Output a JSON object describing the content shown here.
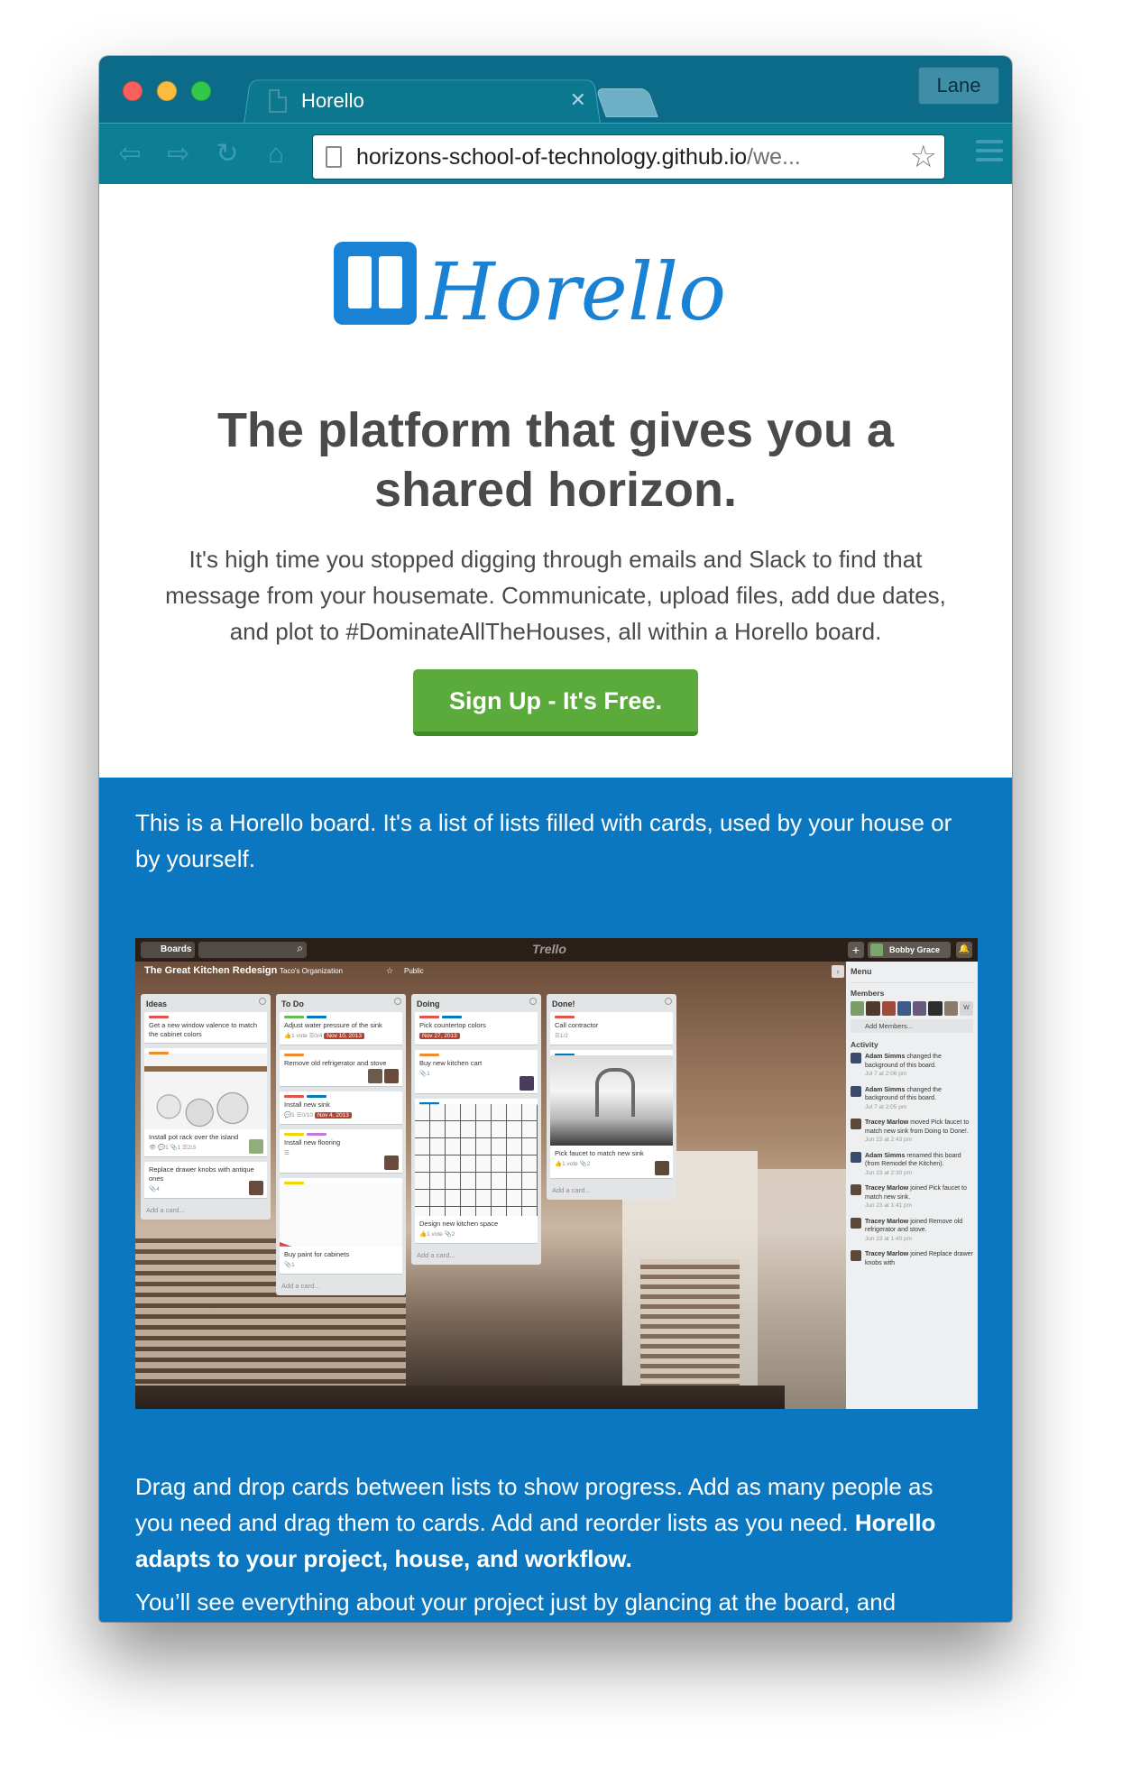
{
  "browser": {
    "tab_title": "Horello",
    "tab_close": "✕",
    "profile_name": "Lane",
    "url_host": "horizons-school-of-technology.github.io",
    "url_rest": "/we...",
    "nav": {
      "back": "⇦",
      "forward": "⇨",
      "reload": "↻",
      "home": "⌂",
      "star": "☆"
    }
  },
  "hero": {
    "logo_text": "Horello",
    "headline": "The platform that gives you a shared horizon.",
    "intro": "It's high time you stopped digging through emails and Slack to find that message from your housemate. Communicate, upload files, add due dates, and plot to #DominateAllTheHouses, all within a Horello board.",
    "signup_label": "Sign Up - It's Free.",
    "colors": {
      "brand_blue": "#1a82d4",
      "signup_green": "#5aaa3c",
      "text_gray": "#4a4a4a"
    }
  },
  "section": {
    "background": "#0a77c0",
    "p1": "This is a Horello board. It's a list of lists filled with cards, used by your house or by yourself.",
    "p2_plain": "Drag and drop cards between lists to show progress. Add as many people as you need and drag them to cards. Add and reorder lists as you need.",
    "p2_bold": "Horello adapts to your project, house, and workflow.",
    "p3": "You’ll see everything about your project just by glancing at the board, and"
  },
  "board": {
    "header": {
      "boards_btn": "Boards",
      "search_icon": "⌕",
      "brand": "Trello",
      "plus": "+",
      "user": "Bobby Grace",
      "bell": "🔔"
    },
    "name": "The Great Kitchen Redesign",
    "org": "Taco's Organization",
    "star": "☆",
    "visibility": "Public",
    "collapse": "›",
    "add_card": "Add a card...",
    "lists": [
      {
        "title": "Ideas",
        "cards": [
          {
            "text": "Get a new window valence to match the cabinet colors"
          },
          {
            "text": "Install pot rack over the island",
            "meta": "👁  💬1  📎1  ☰2/3"
          },
          {
            "text": "Replace drawer knobs with antique ones",
            "meta": "📎4"
          }
        ]
      },
      {
        "title": "To Do",
        "cards": [
          {
            "text": "Adjust water pressure of the sink",
            "meta": "👍1 vote  ☰0/4",
            "due": "Nov 10, 2013"
          },
          {
            "text": "Remove old refrigerator and stove"
          },
          {
            "text": "Install new sink",
            "meta": "💬1  ☰0/10",
            "due": "Nov 4, 2013"
          },
          {
            "text": "Install new flooring",
            "meta": "☰"
          },
          {
            "text": "Buy paint for cabinets",
            "meta": "📎1"
          }
        ]
      },
      {
        "title": "Doing",
        "cards": [
          {
            "text": "Pick countertop colors",
            "due": "Nov 27, 2013"
          },
          {
            "text": "Buy new kitchen cart",
            "meta": "📎1"
          },
          {
            "text": "Design new kitchen space",
            "meta": "👍1 vote  📎2"
          }
        ]
      },
      {
        "title": "Done!",
        "cards": [
          {
            "text": "Call contractor",
            "meta": "☰1/2"
          },
          {
            "text": "Pick faucet to match new sink",
            "meta": "👍1 vote  📎2"
          }
        ]
      }
    ],
    "sidebar": {
      "menu": "Menu",
      "members_heading": "Members",
      "members_extra": "W",
      "add_members": "Add Members...",
      "activity_heading": "Activity",
      "activity": [
        {
          "who": "Adam Simms",
          "what": "changed the background of this board.",
          "when": "Jul 7 at 2:06 pm"
        },
        {
          "who": "Adam Simms",
          "what": "changed the background of this board.",
          "when": "Jul 7 at 2:05 pm"
        },
        {
          "who": "Tracey Marlow",
          "what": "moved Pick faucet to match new sink from Doing to Done!.",
          "when": "Jun 23 at 2:43 pm"
        },
        {
          "who": "Adam Simms",
          "what": "renamed this board (from Remodel the Kitchen).",
          "when": "Jun 23 at 2:30 pm"
        },
        {
          "who": "Tracey Marlow",
          "what": "joined Pick faucet to match new sink.",
          "when": "Jun 23 at 1:41 pm"
        },
        {
          "who": "Tracey Marlow",
          "what": "joined Remove old refrigerator and stove.",
          "when": "Jun 23 at 1:40 pm"
        },
        {
          "who": "Tracey Marlow",
          "what": "joined Replace drawer knobs with",
          "when": ""
        }
      ]
    }
  }
}
